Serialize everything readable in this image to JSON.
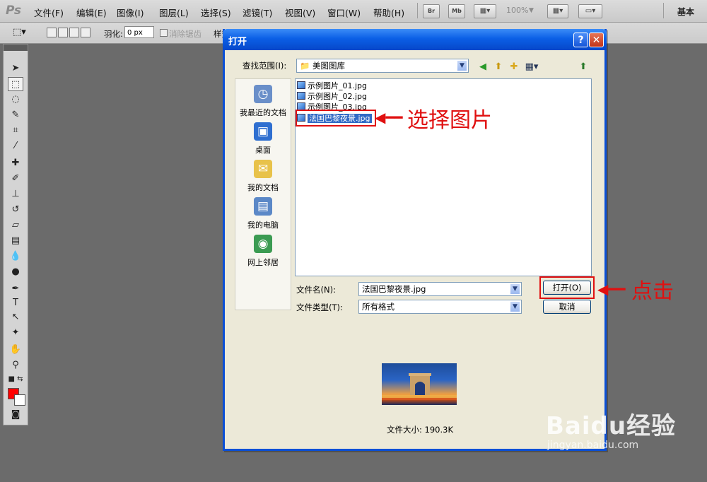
{
  "app": {
    "logo": "Ps",
    "workspace": "基本"
  },
  "menubar": {
    "items": [
      "文件(F)",
      "编辑(E)",
      "图像(I)",
      "图层(L)",
      "选择(S)",
      "滤镜(T)",
      "视图(V)",
      "窗口(W)",
      "帮助(H)"
    ],
    "zoom": "100%",
    "bridge_label": "Br",
    "minibridge_label": "Mb"
  },
  "options_bar": {
    "feather_label": "羽化:",
    "feather_value": "0 px",
    "antialias_label": "消除锯齿",
    "style_label": "样式"
  },
  "colors": {
    "foreground": "#ff0000",
    "background": "#ffffff",
    "annotation": "#e01010",
    "title_bar": "#0b5fe6"
  },
  "dialog": {
    "title": "打开",
    "help_label": "?",
    "close_label": "✕",
    "look_in_label": "查找范围(I):",
    "look_in_value": "美图图库",
    "places": [
      {
        "label": "我最近的文档",
        "icon": "recent-documents-icon"
      },
      {
        "label": "桌面",
        "icon": "desktop-icon"
      },
      {
        "label": "我的文档",
        "icon": "my-documents-icon"
      },
      {
        "label": "我的电脑",
        "icon": "my-computer-icon"
      },
      {
        "label": "网上邻居",
        "icon": "network-places-icon"
      }
    ],
    "files": [
      {
        "name": "示例图片_01.jpg",
        "selected": false
      },
      {
        "name": "示例图片_02.jpg",
        "selected": false
      },
      {
        "name": "示例图片_03.jpg",
        "selected": false
      },
      {
        "name": "法国巴黎夜景.jpg",
        "selected": true
      }
    ],
    "filename_label": "文件名(N):",
    "filename_value": "法国巴黎夜景.jpg",
    "filetype_label": "文件类型(T):",
    "filetype_value": "所有格式",
    "open_label": "打开(O)",
    "cancel_label": "取消",
    "file_size": "文件大小: 190.3K"
  },
  "annotations": {
    "select_image": "选择图片",
    "click": "点击"
  },
  "watermark": {
    "main": "Baidu经验",
    "sub": "jingyan.baidu.com"
  }
}
